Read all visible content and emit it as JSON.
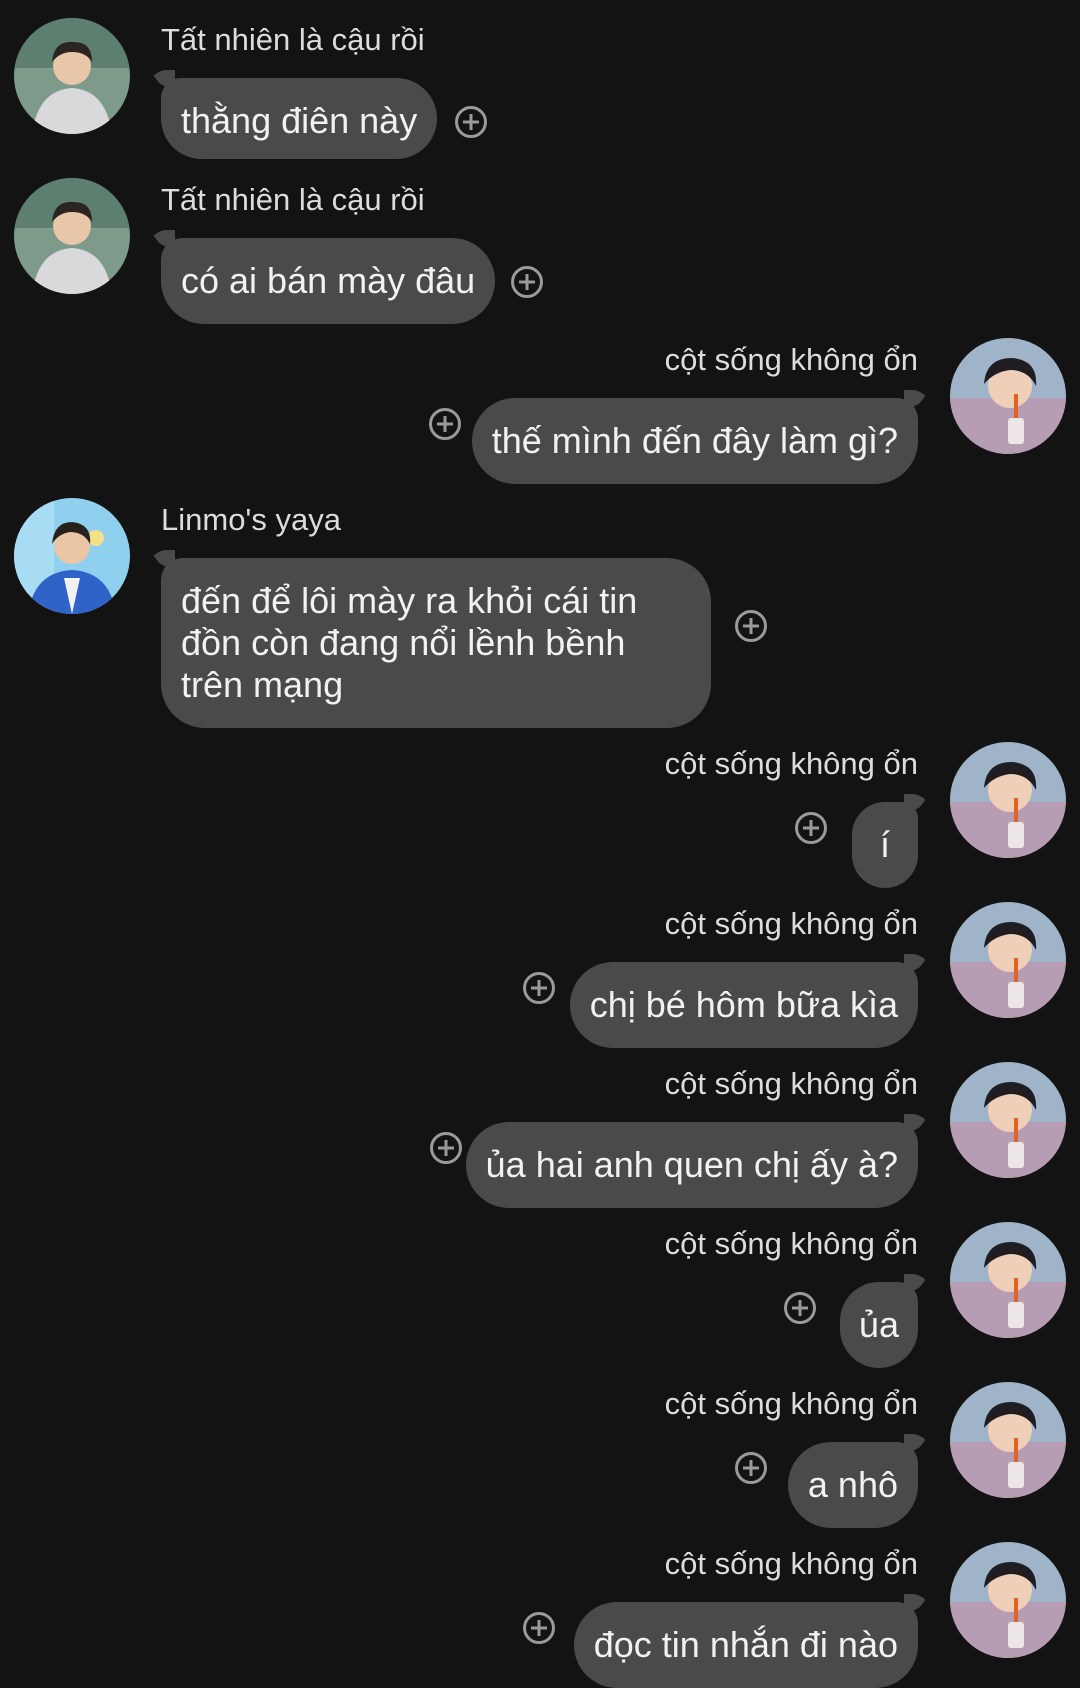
{
  "messages": [
    {
      "side": "left",
      "sender": "Tất nhiên là cậu rồi",
      "text": "thằng điên này",
      "avatar": "avatar-boy-hoodie"
    },
    {
      "side": "left",
      "sender": "Tất nhiên là cậu rồi",
      "text": "có ai bán mày đâu",
      "avatar": "avatar-boy-hoodie"
    },
    {
      "side": "right",
      "sender": "cột sống không ổn",
      "text": "thế mình đến đây làm gì?",
      "avatar": "avatar-boy-straw"
    },
    {
      "side": "left",
      "sender": "Linmo's yaya",
      "text": "đến để lôi mày ra khỏi cái tin đồn còn đang nổi lềnh bềnh trên mạng",
      "avatar": "avatar-boy-blue-jacket"
    },
    {
      "side": "right",
      "sender": "cột sống không ổn",
      "text": "í",
      "avatar": "avatar-boy-straw"
    },
    {
      "side": "right",
      "sender": "cột sống không ổn",
      "text": "chị bé hôm bữa kìa",
      "avatar": "avatar-boy-straw"
    },
    {
      "side": "right",
      "sender": "cột sống không ổn",
      "text": "ủa hai anh quen chị ấy à?",
      "avatar": "avatar-boy-straw"
    },
    {
      "side": "right",
      "sender": "cột sống không ổn",
      "text": "ủa",
      "avatar": "avatar-boy-straw"
    },
    {
      "side": "right",
      "sender": "cột sống không ổn",
      "text": "a nhô",
      "avatar": "avatar-boy-straw"
    },
    {
      "side": "right",
      "sender": "cột sống không ổn",
      "text": "đọc tin nhắn đi nào",
      "avatar": "avatar-boy-straw"
    }
  ],
  "colors": {
    "background": "#131313",
    "bubble": "#4a4a4a",
    "text": "#f2f2f2",
    "sender": "#dcdcdc",
    "reaction_icon": "#9a9a9a"
  },
  "icons": {
    "reaction": "add-reaction-icon"
  }
}
